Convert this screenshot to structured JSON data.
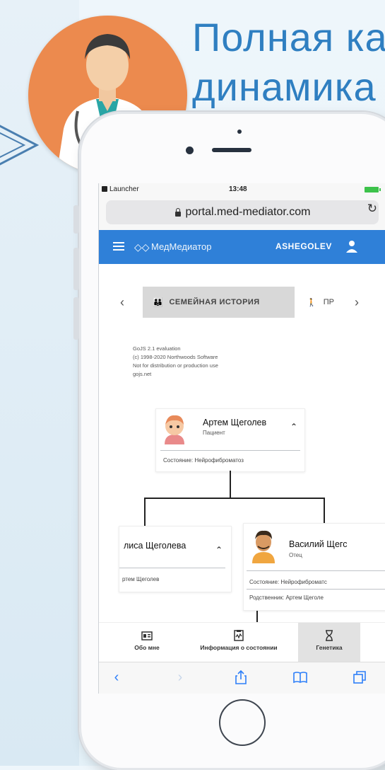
{
  "headline": {
    "line1": "Полная ка",
    "line2": "динамика"
  },
  "statusbar": {
    "carrier": "Launcher",
    "time": "13:48"
  },
  "browser": {
    "url": "portal.med-mediator.com"
  },
  "appbar": {
    "brand": "МедМедиатор",
    "username": "ASHEGOLEV"
  },
  "tabs": {
    "active_label": "СЕМЕЙНАЯ ИСТОРИЯ",
    "next_label": "ПР",
    "prev_arrow": "‹",
    "next_arrow": "›"
  },
  "watermark": [
    "GoJS 2.1 evaluation",
    "(c) 1998-2020 Northwoods Software",
    "Not for distribution or production use",
    "gojs.net"
  ],
  "tree": {
    "patient": {
      "name": "Артем Щеголев",
      "role": "Пациент",
      "info": "Состояние: Нейрофиброматоз"
    },
    "mother": {
      "name": "лиса Щеголева",
      "info": "ртем Щеголев"
    },
    "father": {
      "name": "Василий Щегс",
      "role": "Отец",
      "info1": "Состояние: Нейрофиброматс",
      "info2": "Родственник: Артем Щеголе"
    }
  },
  "bottom_nav": [
    {
      "label": "Обо мне",
      "icon": "id-card-icon"
    },
    {
      "label": "Информация о состоянии",
      "icon": "medical-chart-icon"
    },
    {
      "label": "Генетика",
      "icon": "hourglass-icon",
      "active": true
    }
  ],
  "colors": {
    "accent": "#2f80d8",
    "headline": "#2f7fc1",
    "avatar_bg": "#ec8a4e"
  }
}
